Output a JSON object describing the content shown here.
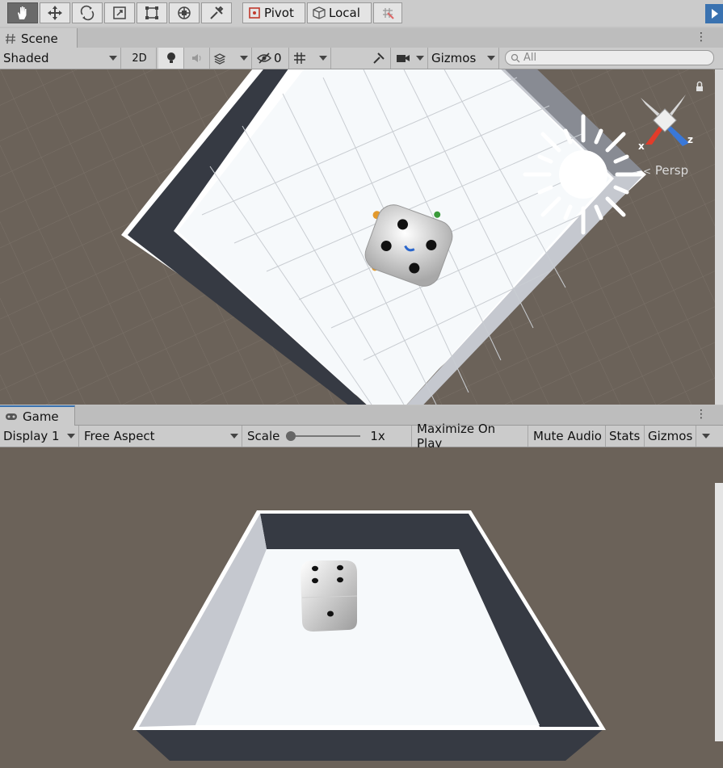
{
  "toolbar": {
    "tools": [
      "hand-tool",
      "move-tool",
      "rotate-tool",
      "scale-tool",
      "rect-tool",
      "transform-tool",
      "custom-tool"
    ],
    "pivot_label": "Pivot",
    "local_label": "Local"
  },
  "scene": {
    "tab_label": "Scene",
    "shading_mode": "Shaded",
    "mode_2d_label": "2D",
    "hidden_count": "0",
    "gizmos_label": "Gizmos",
    "search_placeholder": "All",
    "persp_label": "Persp",
    "axis_x": "x",
    "axis_z": "z"
  },
  "game": {
    "tab_label": "Game",
    "display": "Display 1",
    "aspect": "Free Aspect",
    "scale_label": "Scale",
    "scale_value": "1x",
    "maximize_label": "Maximize On Play",
    "mute_label": "Mute Audio",
    "stats_label": "Stats",
    "gizmos_label": "Gizmos"
  },
  "colors": {
    "viewport_bg": "#6b6259",
    "floor": "#f6f9fb",
    "wall_dark": "#363a43",
    "wall_light": "#c5c8cf",
    "accent_blue": "#3a72b0"
  }
}
